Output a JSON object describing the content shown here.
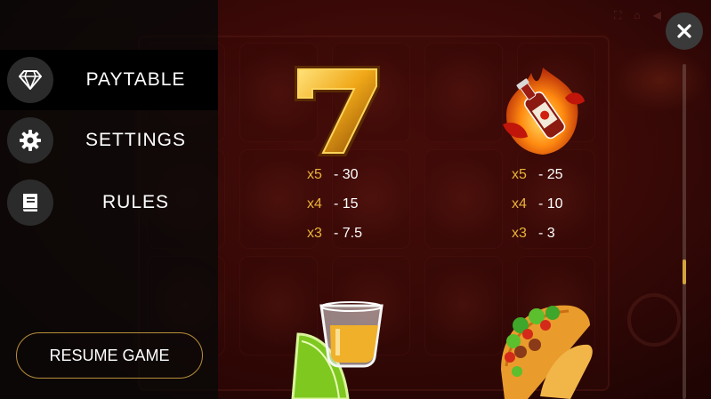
{
  "menu": {
    "items": [
      {
        "label": "PAYTABLE",
        "icon": "diamond-icon",
        "active": true
      },
      {
        "label": "SETTINGS",
        "icon": "gear-icon",
        "active": false
      },
      {
        "label": "RULES",
        "icon": "book-icon",
        "active": false
      }
    ],
    "resume_label": "RESUME GAME"
  },
  "paytable": {
    "symbols": [
      {
        "icon": "seven-icon",
        "payouts": [
          {
            "mult": "x5",
            "value": "- 30"
          },
          {
            "mult": "x4",
            "value": "- 15"
          },
          {
            "mult": "x3",
            "value": "- 7.5"
          }
        ]
      },
      {
        "icon": "hot-sauce-icon",
        "payouts": [
          {
            "mult": "x5",
            "value": "- 25"
          },
          {
            "mult": "x4",
            "value": "- 10"
          },
          {
            "mult": "x3",
            "value": "- 3"
          }
        ]
      },
      {
        "icon": "tequila-lime-icon"
      },
      {
        "icon": "taco-icon"
      }
    ]
  },
  "close_icon": "close-icon",
  "colors": {
    "accent_gold": "#e8b33a",
    "button_border": "#b88f3a",
    "sidebar_bg": "#080808"
  }
}
